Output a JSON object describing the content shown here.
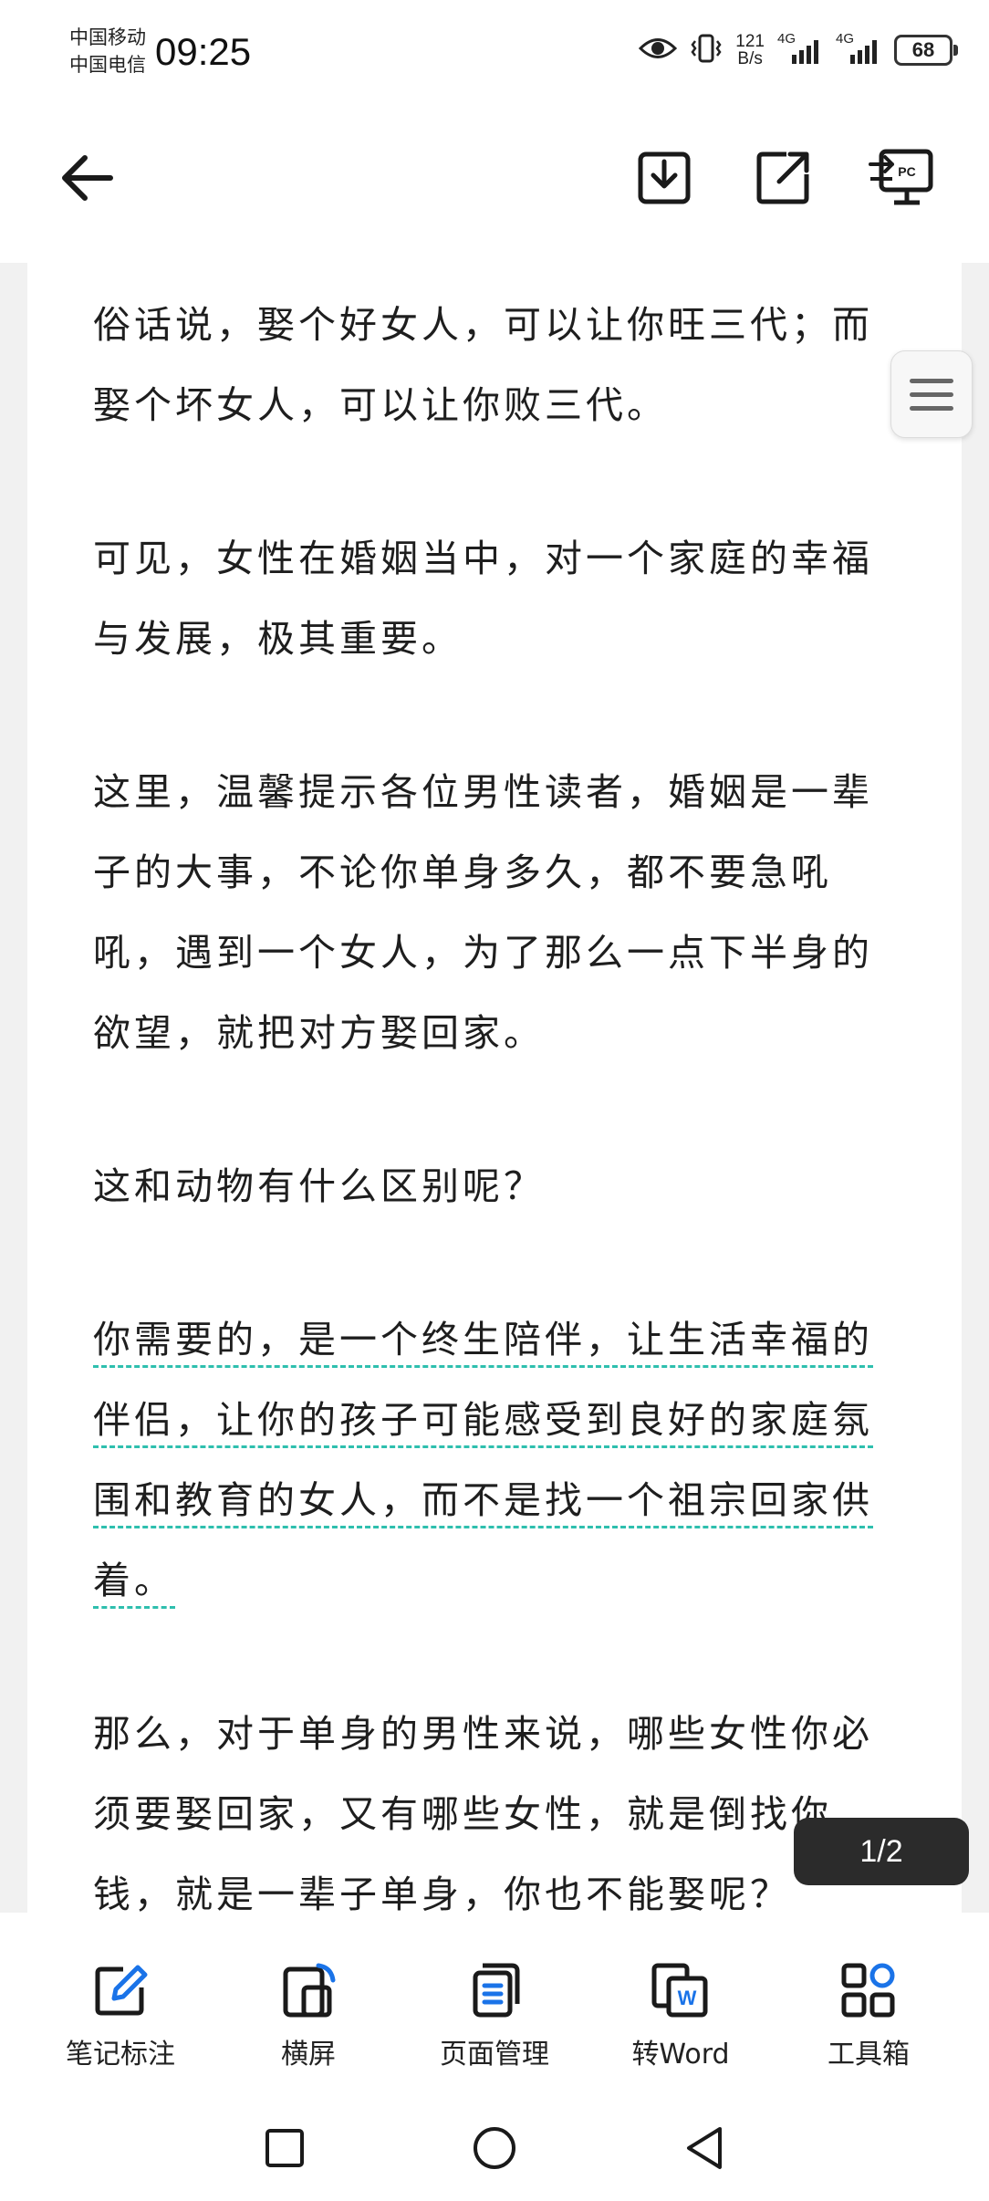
{
  "status_bar": {
    "carrier_1": "中国移动",
    "carrier_2": "中国电信",
    "time": "09:25",
    "net_speed_value": "121",
    "net_speed_unit": "B/s",
    "signal_1_label": "4G",
    "signal_2_label": "4G",
    "battery": "68"
  },
  "toolbar": {
    "back_icon": "arrow-left-icon",
    "download_icon": "download-icon",
    "share_icon": "share-icon",
    "pc_icon": "pc-cast-icon",
    "pc_label": "PC"
  },
  "document": {
    "paragraphs": [
      {
        "lines": [
          "俗话说，娶个好女人，可以让你旺三代；而",
          "娶个坏女人，可以让你败三代。"
        ]
      },
      {
        "lines": [
          "可见，女性在婚姻当中，对一个家庭的幸福",
          "与发展，极其重要。"
        ]
      },
      {
        "lines": [
          "这里，温馨提示各位男性读者，婚姻是一辈",
          "子的大事，不论你单身多久，都不要急吼",
          "吼，遇到一个女人，为了那么一点下半身的",
          "欲望，就把对方娶回家。"
        ]
      },
      {
        "lines": [
          "这和动物有什么区别呢？"
        ]
      },
      {
        "lines": [
          "你需要的，是一个终生陪伴，让生活幸福的",
          "伴侣，让你的孩子可能感受到良好的家庭氛",
          "围和教育的女人，而不是找一个祖宗回家供",
          "着。"
        ],
        "highlighted": true
      },
      {
        "lines": [
          "那么，对于单身的男性来说，哪些女性你必",
          "须要娶回家，又有哪些女性，就是倒找你",
          "钱，就是一辈子单身，你也不能娶呢？"
        ]
      }
    ],
    "page_indicator": "1/2"
  },
  "actions": [
    {
      "label": "笔记标注",
      "icon": "note-edit-icon"
    },
    {
      "label": "横屏",
      "icon": "rotate-landscape-icon"
    },
    {
      "label": "页面管理",
      "icon": "page-manage-icon"
    },
    {
      "label": "转Word",
      "icon": "word-convert-icon",
      "badge": "W"
    },
    {
      "label": "工具箱",
      "icon": "toolbox-icon"
    }
  ],
  "colors": {
    "accent": "#1a73e8",
    "highlight_underline": "#2ebfae",
    "page_background": "#f1f1f1"
  }
}
